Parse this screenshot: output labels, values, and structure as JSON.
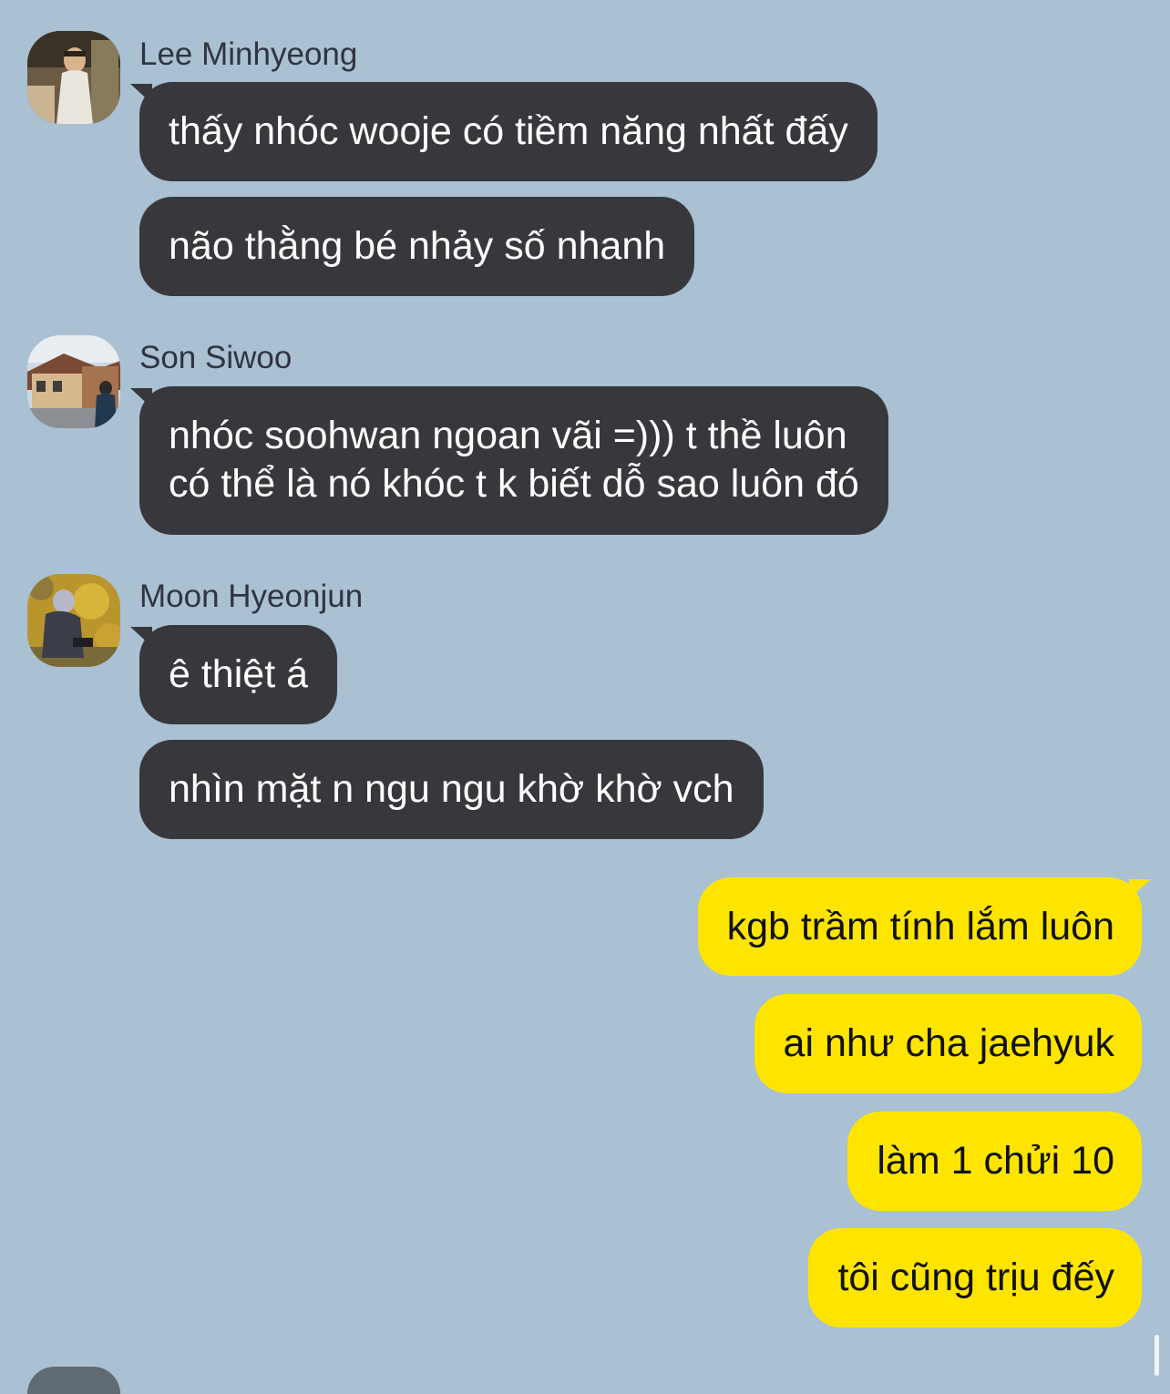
{
  "messages": [
    {
      "sender": "Lee Minhyeong",
      "avatar_icon": "person-photo-avatar",
      "bubbles": [
        "thấy nhóc wooje có tiềm năng nhất đấy",
        "não thằng bé nhảy số nhanh"
      ]
    },
    {
      "sender": "Son Siwoo",
      "avatar_icon": "street-photo-avatar",
      "bubbles": [
        "nhóc soohwan ngoan vãi =))) t thề luôn\ncó thể là nó khóc t k biết dỗ sao luôn đó"
      ]
    },
    {
      "sender": "Moon Hyeonjun",
      "avatar_icon": "autumn-photo-avatar",
      "bubbles": [
        "ê thiệt á",
        "nhìn mặt n ngu ngu khờ khờ vch"
      ]
    }
  ],
  "my_messages": [
    "kgb trầm tính lắm luôn",
    "ai như cha jaehyuk",
    "làm 1 chửi 10",
    "tôi cũng trịu đếy"
  ],
  "colors": {
    "background": "#aac0d3",
    "incoming_bubble": "#38383c",
    "outgoing_bubble": "#fee500",
    "incoming_text": "#ffffff",
    "outgoing_text": "#111111"
  }
}
